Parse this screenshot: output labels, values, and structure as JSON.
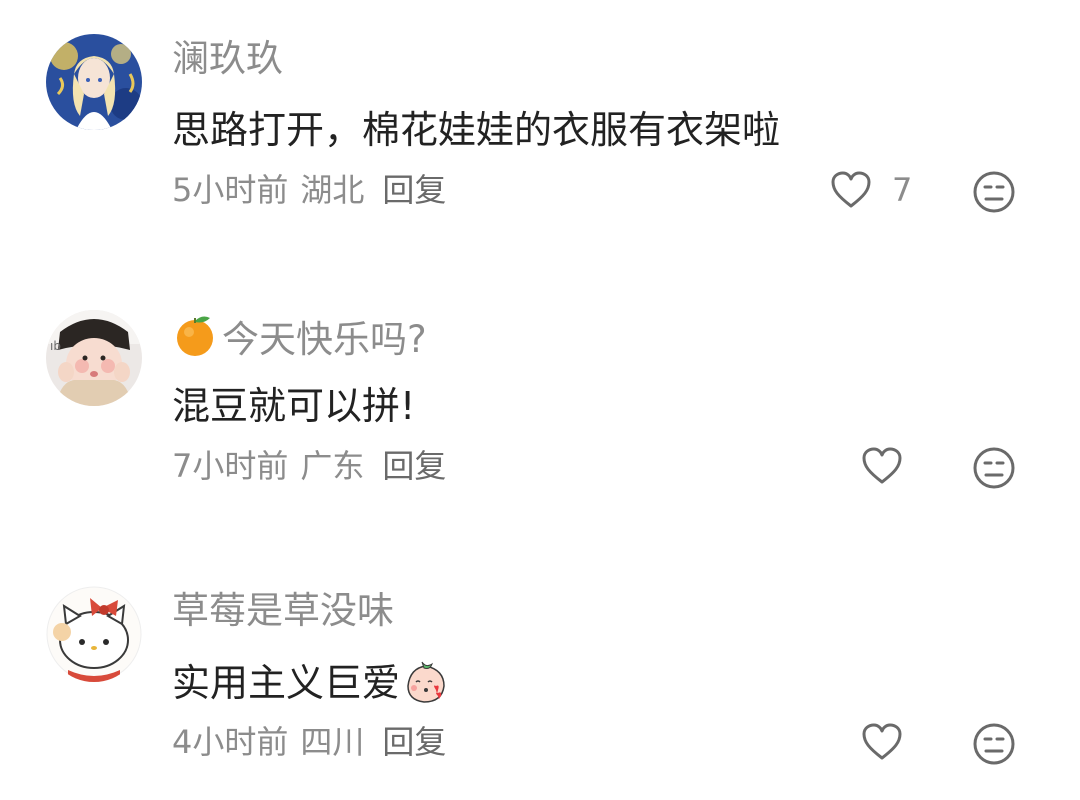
{
  "comments": [
    {
      "username": "澜玖玖",
      "avatar": "anime-girl-avatar",
      "content": "思路打开，棉花娃娃的衣服有衣架啦",
      "time": "5小时前",
      "location": "湖北",
      "reply_label": "回复",
      "like_count": "7",
      "like_icon": "heart-outline-icon",
      "dislike_icon": "meh-face-icon"
    },
    {
      "username": "今天快乐吗?",
      "username_emoji": "tangerine-emoji",
      "avatar": "baby-photo-avatar",
      "content": "混豆就可以拼!",
      "time": "7小时前",
      "location": "广东",
      "reply_label": "回复",
      "like_count": "",
      "like_icon": "heart-outline-icon",
      "dislike_icon": "meh-face-icon"
    },
    {
      "username": "草莓是草没味",
      "avatar": "hello-kitty-avatar",
      "content": "实用主义巨爱",
      "content_sticker": "peach-kiss-sticker",
      "time": "4小时前",
      "location": "四川",
      "reply_label": "回复",
      "like_count": "",
      "like_icon": "heart-outline-icon",
      "dislike_icon": "meh-face-icon"
    }
  ],
  "colors": {
    "username": "#8c8c8c",
    "content": "#222222",
    "meta": "#8c8c8c",
    "icon_stroke": "#6a6a6a",
    "background": "#ffffff"
  }
}
